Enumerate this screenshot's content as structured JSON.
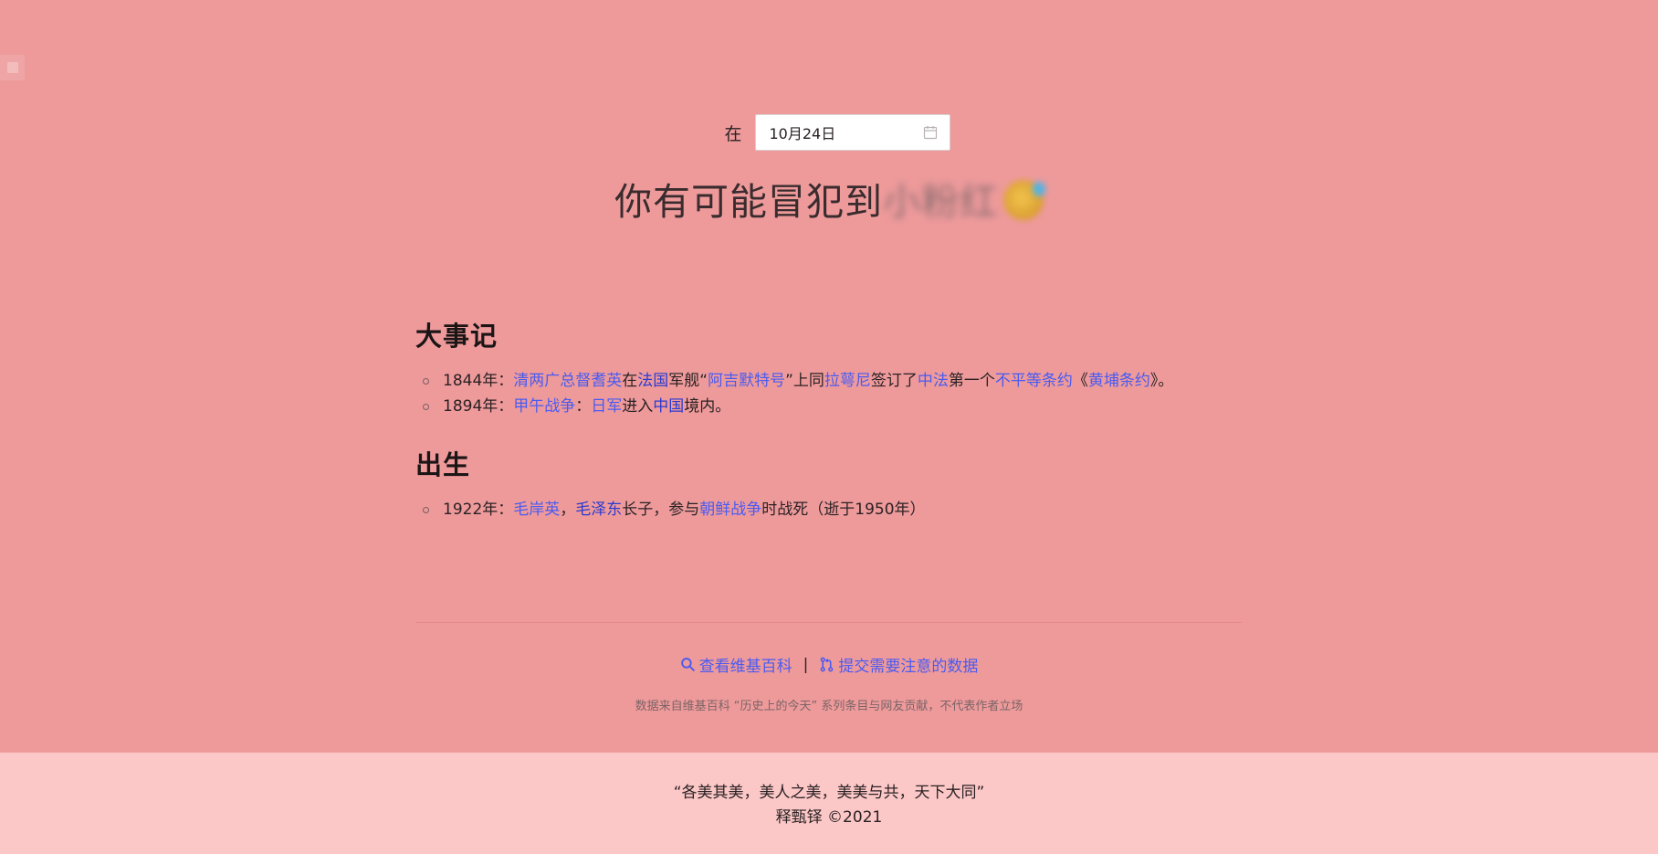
{
  "date_picker": {
    "prefix": "在",
    "value": "10月24日",
    "icon": "calendar-icon"
  },
  "headline": {
    "text": "你有可能冒犯到",
    "blurred_text": "小粉红"
  },
  "sections": {
    "events": {
      "title": "大事记",
      "items": [
        {
          "segments": [
            {
              "text": "1844年：",
              "link": false
            },
            {
              "text": "清两广总督耆英",
              "link": true
            },
            {
              "text": "在",
              "link": false
            },
            {
              "text": "法国",
              "link": true,
              "visited": true
            },
            {
              "text": "军舰“",
              "link": false
            },
            {
              "text": "阿吉默特号",
              "link": true
            },
            {
              "text": "”上同",
              "link": false
            },
            {
              "text": "拉萼尼",
              "link": true
            },
            {
              "text": "签订了",
              "link": false
            },
            {
              "text": "中法",
              "link": true
            },
            {
              "text": "第一个",
              "link": false
            },
            {
              "text": "不平等条约",
              "link": true
            },
            {
              "text": "《",
              "link": false
            },
            {
              "text": "黄埔条约",
              "link": true
            },
            {
              "text": "》。",
              "link": false
            }
          ]
        },
        {
          "segments": [
            {
              "text": "1894年：",
              "link": false
            },
            {
              "text": "甲午战争",
              "link": true
            },
            {
              "text": "：",
              "link": false
            },
            {
              "text": "日军",
              "link": true
            },
            {
              "text": "进入",
              "link": false
            },
            {
              "text": "中国",
              "link": true,
              "visited": true
            },
            {
              "text": "境内。",
              "link": false
            }
          ]
        }
      ]
    },
    "births": {
      "title": "出生",
      "items": [
        {
          "segments": [
            {
              "text": "1922年：",
              "link": false
            },
            {
              "text": "毛岸英",
              "link": true
            },
            {
              "text": "，",
              "link": false
            },
            {
              "text": "毛泽东",
              "link": true,
              "visited": true
            },
            {
              "text": "长子，参与",
              "link": false
            },
            {
              "text": "朝鲜战争",
              "link": true
            },
            {
              "text": "时战死（逝于1950年）",
              "link": false
            }
          ]
        }
      ]
    }
  },
  "actions": {
    "wiki_label": "查看维基百科",
    "separator": "|",
    "submit_label": "提交需要注意的数据"
  },
  "note": "数据来自维基百科 “历史上的今天” 系列条目与网友贡献，不代表作者立场",
  "footer": {
    "quote": "“各美其美，美人之美，美美与共，天下大同”",
    "credit": "释甄铎 ©2021"
  },
  "colors": {
    "background": "#ee9a9b",
    "footer_background": "#fcc8c7",
    "link": "#4a5bf0",
    "link_visited": "#2a3ad0"
  }
}
